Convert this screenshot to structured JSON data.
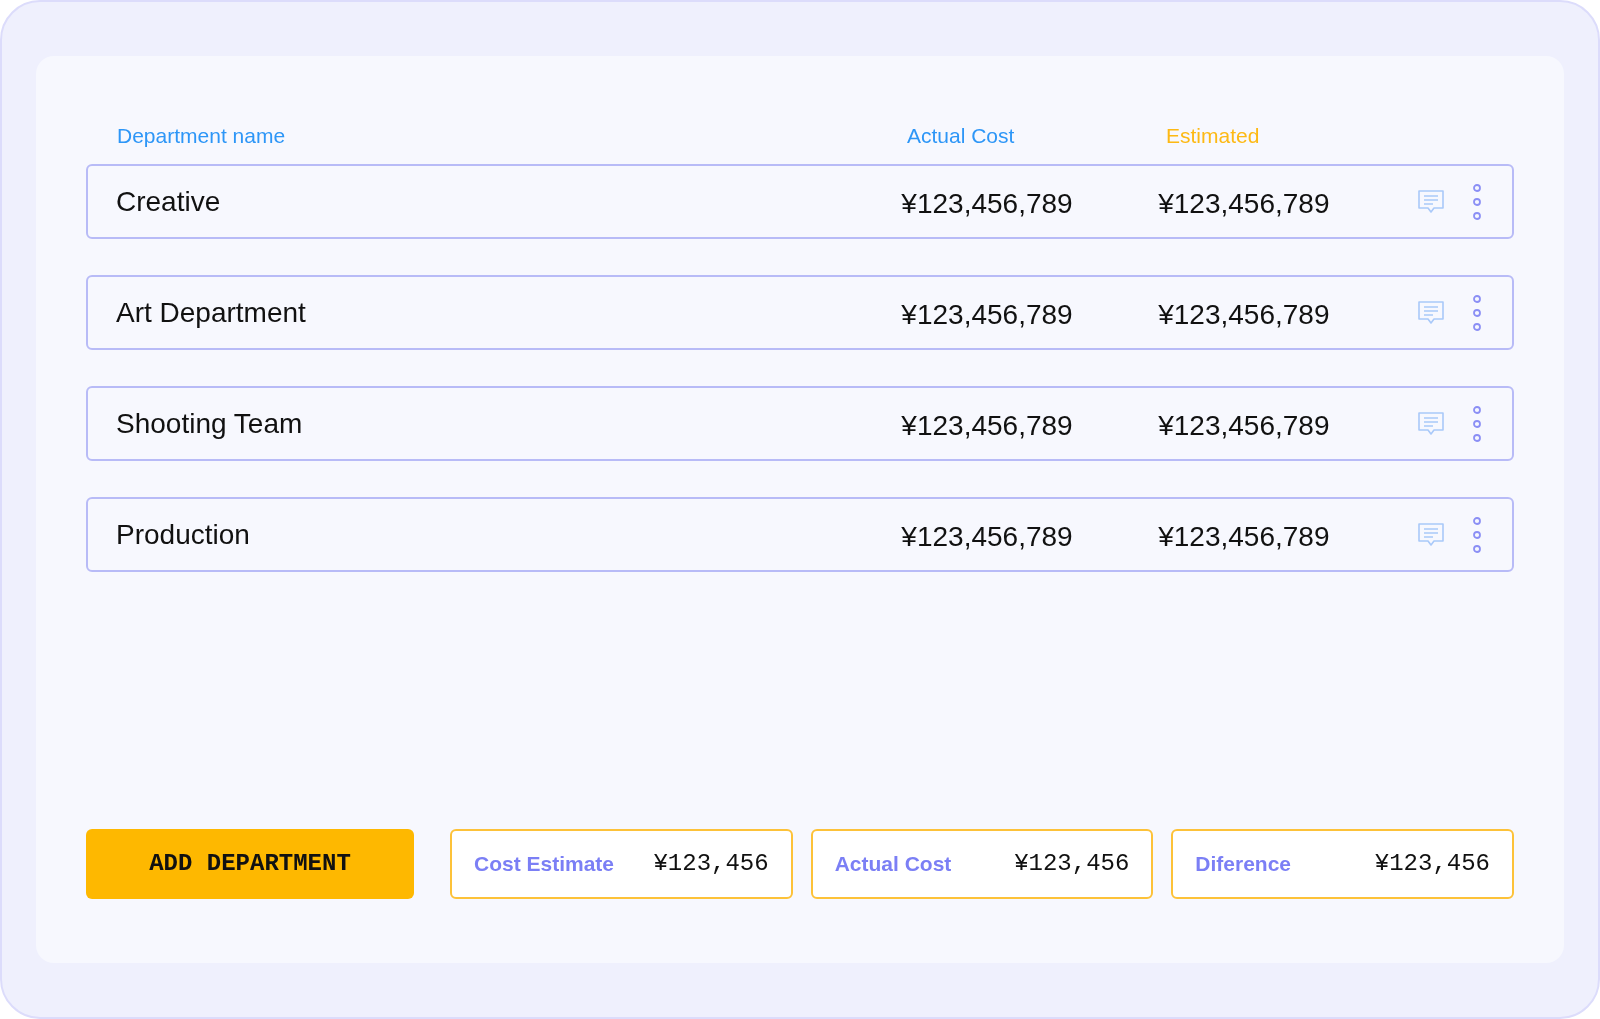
{
  "columns": [
    {
      "label": "Department name",
      "color": "#2d96f7"
    },
    {
      "label": "Actual Cost",
      "color": "#2d96f7"
    },
    {
      "label": "Estimated",
      "color": "#fdb914"
    }
  ],
  "rows": [
    {
      "name": "Creative",
      "actual": "¥123,456,789",
      "estimated": "¥123,456,789"
    },
    {
      "name": "Art Department",
      "actual": "¥123,456,789",
      "estimated": "¥123,456,789"
    },
    {
      "name": "Shooting Team",
      "actual": "¥123,456,789",
      "estimated": "¥123,456,789"
    },
    {
      "name": "Production",
      "actual": "¥123,456,789",
      "estimated": "¥123,456,789"
    }
  ],
  "add_button": "ADD DEPARTMENT",
  "summary": [
    {
      "label": "Cost Estimate",
      "value": "¥123,456"
    },
    {
      "label": "Actual Cost",
      "value": "¥123,456"
    },
    {
      "label": "Diference",
      "value": "¥123,456"
    }
  ]
}
